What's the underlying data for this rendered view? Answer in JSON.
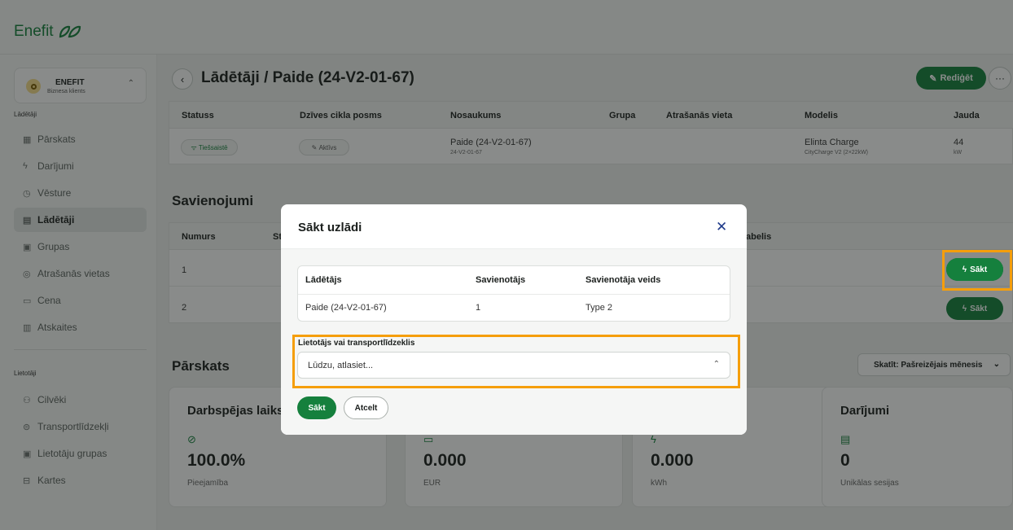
{
  "brand": {
    "name": "Enefit"
  },
  "client": {
    "name": "ENEFIT",
    "type": "Biznesa klients"
  },
  "sidebar": {
    "section1": "Lādētāji",
    "items1": [
      {
        "label": "Pārskats",
        "icon": "grid-icon"
      },
      {
        "label": "Darījumi",
        "icon": "bolt-icon"
      },
      {
        "label": "Vēsture",
        "icon": "clock-icon"
      },
      {
        "label": "Lādētāji",
        "icon": "charger-icon"
      },
      {
        "label": "Grupas",
        "icon": "groups-icon"
      },
      {
        "label": "Atrašanās vietas",
        "icon": "pin-icon"
      },
      {
        "label": "Cena",
        "icon": "wallet-icon"
      },
      {
        "label": "Atskaites",
        "icon": "chart-icon"
      }
    ],
    "section2": "Lietotāji",
    "items2": [
      {
        "label": "Cilvēki",
        "icon": "people-icon"
      },
      {
        "label": "Transportlīdzekļi",
        "icon": "car-icon"
      },
      {
        "label": "Lietotāju grupas",
        "icon": "user-groups-icon"
      },
      {
        "label": "Kartes",
        "icon": "card-icon"
      }
    ]
  },
  "header": {
    "title": "Lādētāji / Paide (24-V2-01-67)",
    "edit_label": "Rediģēt",
    "more_label": "···"
  },
  "charger_table": {
    "headers": [
      "Statuss",
      "Dzīves cikla posms",
      "Nosaukums",
      "Grupa",
      "Atrašanās vieta",
      "Modelis",
      "Jauda"
    ],
    "status": "Tiešsaistē",
    "lifecycle": "Aktīvs",
    "name": "Paide (24-V2-01-67)",
    "name_sub": "24-V2-01-67",
    "model": "Elinta Charge",
    "model_sub": "CityCharge V2 (2×22kW)",
    "power": "44",
    "power_unit": "kW"
  },
  "connections": {
    "title": "Savienojumi",
    "headers": {
      "number": "Numurs",
      "s": "St",
      "cable": "abelis"
    },
    "rows": [
      {
        "number": "1"
      },
      {
        "number": "2"
      }
    ],
    "start_label": "Sākt"
  },
  "overview": {
    "title": "Pārskats",
    "view": "Skatīt: Pašreizējais mēnesis",
    "cards": [
      {
        "title": "Darbspējas laiks",
        "icon": "check-circle-icon",
        "value": "100.0%",
        "unit": "Pieejamība"
      },
      {
        "title": "",
        "icon": "wallet-icon",
        "value": "0.000",
        "unit": "EUR"
      },
      {
        "title": "",
        "icon": "bolt-icon",
        "value": "0.000",
        "unit": "kWh"
      },
      {
        "title": "Darījumi",
        "icon": "charger-icon",
        "value": "0",
        "unit": "Unikālas sesijas"
      }
    ]
  },
  "modal": {
    "title": "Sākt uzlādi",
    "close": "✕",
    "table_headers": [
      "Lādētājs",
      "Savienotājs",
      "Savienotāja veids"
    ],
    "table_row": [
      "Paide (24-V2-01-67)",
      "1",
      "Type 2"
    ],
    "field_label": "Lietotājs vai transportlīdzeklis",
    "field_placeholder": "Lūdzu, atlasiet...",
    "start_label": "Sākt",
    "cancel_label": "Atcelt"
  },
  "colors": {
    "accent": "#15803d",
    "highlight": "#f59e0b"
  }
}
